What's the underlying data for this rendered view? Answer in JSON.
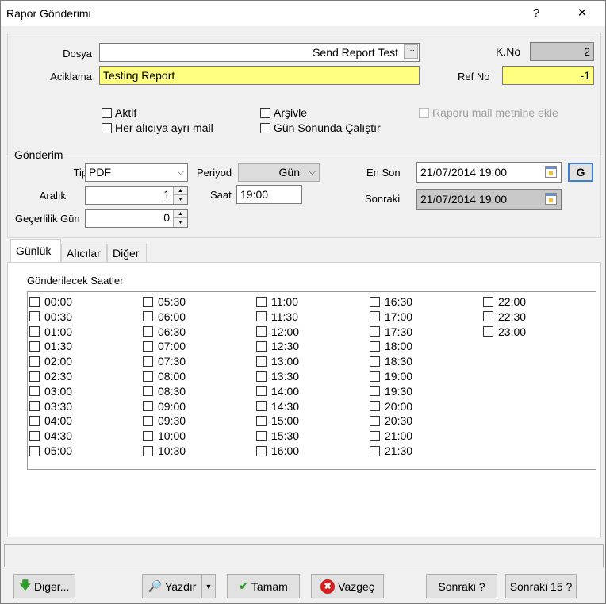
{
  "window": {
    "title": "Rapor Gönderimi",
    "help_label": "?",
    "close_label": "✕"
  },
  "form": {
    "dosya_label": "Dosya",
    "dosya_value": "Send Report Test",
    "browse_label": "···",
    "aciklama_label": "Aciklama",
    "aciklama_value": "Testing Report",
    "kno_label": "K.No",
    "kno_value": "2",
    "refno_label": "Ref No",
    "refno_value": "-1",
    "checkboxes": {
      "aktif": "Aktif",
      "her_aliciya": "Her alıcıya ayrı mail",
      "arsivle": "Arşivle",
      "gun_sonunda": "Gün Sonunda Çalıştır",
      "raporu_mail": "Raporu mail metnine ekle"
    }
  },
  "gonderim": {
    "title": "Gönderim",
    "tipi_label": "Tipi",
    "tipi_value": "PDF",
    "periyod_label": "Periyod",
    "periyod_value": "Gün",
    "aralik_label": "Aralık",
    "aralik_value": "1",
    "saat_label": "Saat",
    "saat_value": "19:00",
    "gecerlilik_label": "Geçerlilik Gün",
    "gecerlilik_value": "0",
    "en_son_label": "En Son",
    "en_son_value": "21/07/2014 19:00",
    "sonraki_label": "Sonraki",
    "sonraki_value": "21/07/2014 19:00",
    "g_button": "G"
  },
  "tabs": [
    "Günlük",
    "Alıcılar",
    "Diğer"
  ],
  "gunluk": {
    "heading": "Gönderilecek Saatler",
    "columns": [
      [
        "00:00",
        "00:30",
        "01:00",
        "01:30",
        "02:00",
        "02:30",
        "03:00",
        "03:30",
        "04:00",
        "04:30",
        "05:00"
      ],
      [
        "05:30",
        "06:00",
        "06:30",
        "07:00",
        "07:30",
        "08:00",
        "08:30",
        "09:00",
        "09:30",
        "10:00",
        "10:30"
      ],
      [
        "11:00",
        "11:30",
        "12:00",
        "12:30",
        "13:00",
        "13:30",
        "14:00",
        "14:30",
        "15:00",
        "15:30",
        "16:00"
      ],
      [
        "16:30",
        "17:00",
        "17:30",
        "18:00",
        "18:30",
        "19:00",
        "19:30",
        "20:00",
        "20:30",
        "21:00",
        "21:30"
      ],
      [
        "22:00",
        "22:30",
        "23:00"
      ]
    ]
  },
  "buttons": {
    "diger": "Diger...",
    "yazdir": "Yazdır",
    "tamam": "Tamam",
    "vazgec": "Vazgeç",
    "sonraki": "Sonraki ?",
    "sonraki15": "Sonraki 15 ?"
  },
  "colors": {
    "yellow_field": "#ffff80",
    "gray_field": "#c8c8c8",
    "green_icon": "#2a9d2a",
    "red_icon": "#d42020"
  }
}
